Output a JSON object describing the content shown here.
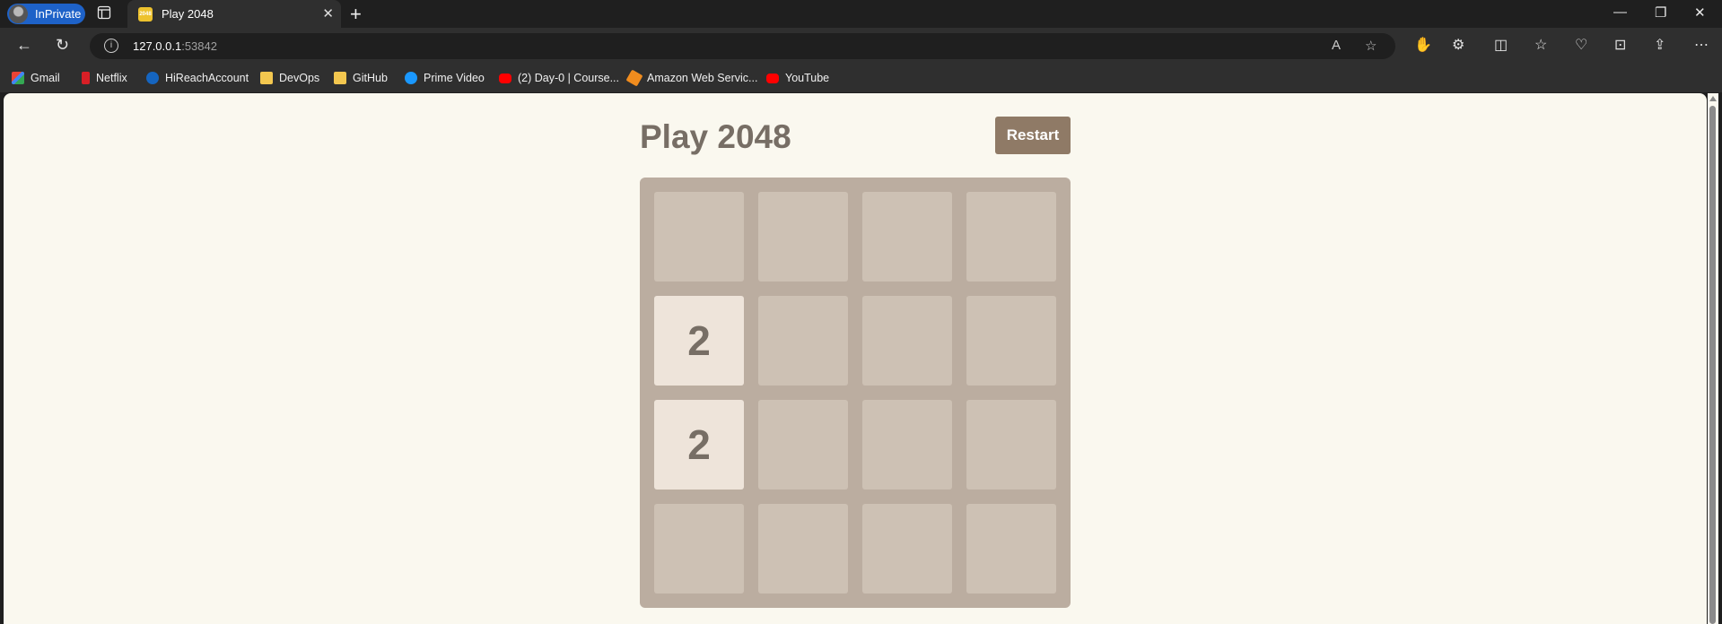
{
  "browser": {
    "profile_label": "InPrivate",
    "tab": {
      "title": "Play 2048",
      "favicon_text": "2048"
    },
    "address": {
      "host": "127.0.0.1",
      "port": ":53842"
    },
    "bookmarks": [
      {
        "label": "Gmail",
        "icon": "gmail"
      },
      {
        "label": "Netflix",
        "icon": "netflix"
      },
      {
        "label": "HiReachAccount",
        "icon": "icr"
      },
      {
        "label": "DevOps",
        "icon": "folder"
      },
      {
        "label": "GitHub",
        "icon": "folder"
      },
      {
        "label": "Prime Video",
        "icon": "prime"
      },
      {
        "label": "(2) Day-0 | Course...",
        "icon": "yt"
      },
      {
        "label": "Amazon Web Servic...",
        "icon": "aws"
      },
      {
        "label": "YouTube",
        "icon": "yt"
      }
    ]
  },
  "game": {
    "title": "Play 2048",
    "restart_label": "Restart",
    "board": [
      [
        "",
        "",
        "",
        ""
      ],
      [
        "2",
        "",
        "",
        ""
      ],
      [
        "2",
        "",
        "",
        ""
      ],
      [
        "",
        "",
        "",
        ""
      ]
    ],
    "colors": {
      "background": "#faf8ef",
      "board": "#bbada0",
      "empty_cell": "#cdc1b4",
      "tile_2": "#eee4da",
      "text": "#776e65",
      "button": "#8f7a66"
    }
  }
}
